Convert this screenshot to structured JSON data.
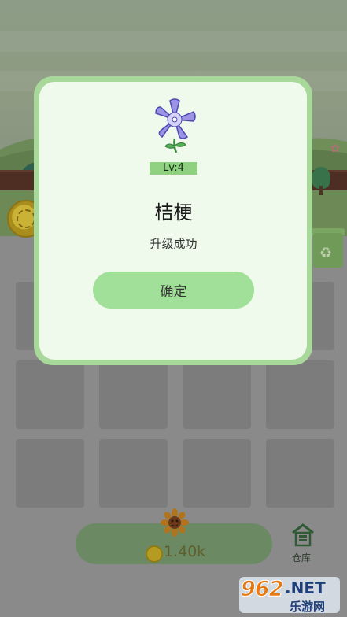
{
  "modal": {
    "level": "Lv:4",
    "plant_name": "桔梗",
    "status": "升级成功",
    "confirm_label": "确定"
  },
  "bottom_bar": {
    "price": "1.40k",
    "warehouse_label": "仓库"
  },
  "watermark": {
    "brand": "962",
    "net": ".NET",
    "tagline": "乐游网"
  },
  "icons": [
    "platycodon-flower-icon",
    "gold-coin-icon",
    "sunflower-icon",
    "warehouse-icon",
    "recycle-bin-icon"
  ],
  "colors": {
    "modal_border": "#a8d89a",
    "modal_bg": "#eff9ec",
    "confirm_button": "#a1e098",
    "level_badge": "#8fd181",
    "flower_petal": "#9c93e6"
  }
}
